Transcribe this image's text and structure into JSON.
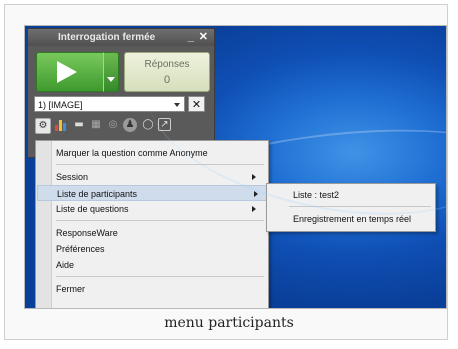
{
  "panel": {
    "title": "Interrogation fermée",
    "minimize": "_",
    "close": "✕",
    "responses_label": "Réponses",
    "responses_count": "0",
    "question_select": "1) [IMAGE]",
    "question_close": "✕"
  },
  "toolbar": {
    "icons": [
      "gear-icon",
      "bar-chart-icon",
      "screen-icon",
      "grid-icon",
      "check-icon",
      "users-icon",
      "speech-bubble-icon",
      "popout-icon"
    ]
  },
  "menu": {
    "items": [
      {
        "label": "Marquer la question comme Anonyme"
      },
      {
        "label": "Session"
      },
      {
        "label": "Liste de participants"
      },
      {
        "label": "Liste de questions"
      },
      {
        "label": "ResponseWare"
      },
      {
        "label": "Préférences"
      },
      {
        "label": "Aide"
      },
      {
        "label": "Fermer"
      }
    ]
  },
  "submenu": {
    "items": [
      {
        "label": "Liste : test2"
      },
      {
        "label": "Enregistrement en temps réel"
      }
    ]
  },
  "caption": "menu participants",
  "colors": {
    "play_green": "#4caf3a",
    "highlight": "#cfdcec",
    "desktop_blue": "#1f6fd3"
  }
}
